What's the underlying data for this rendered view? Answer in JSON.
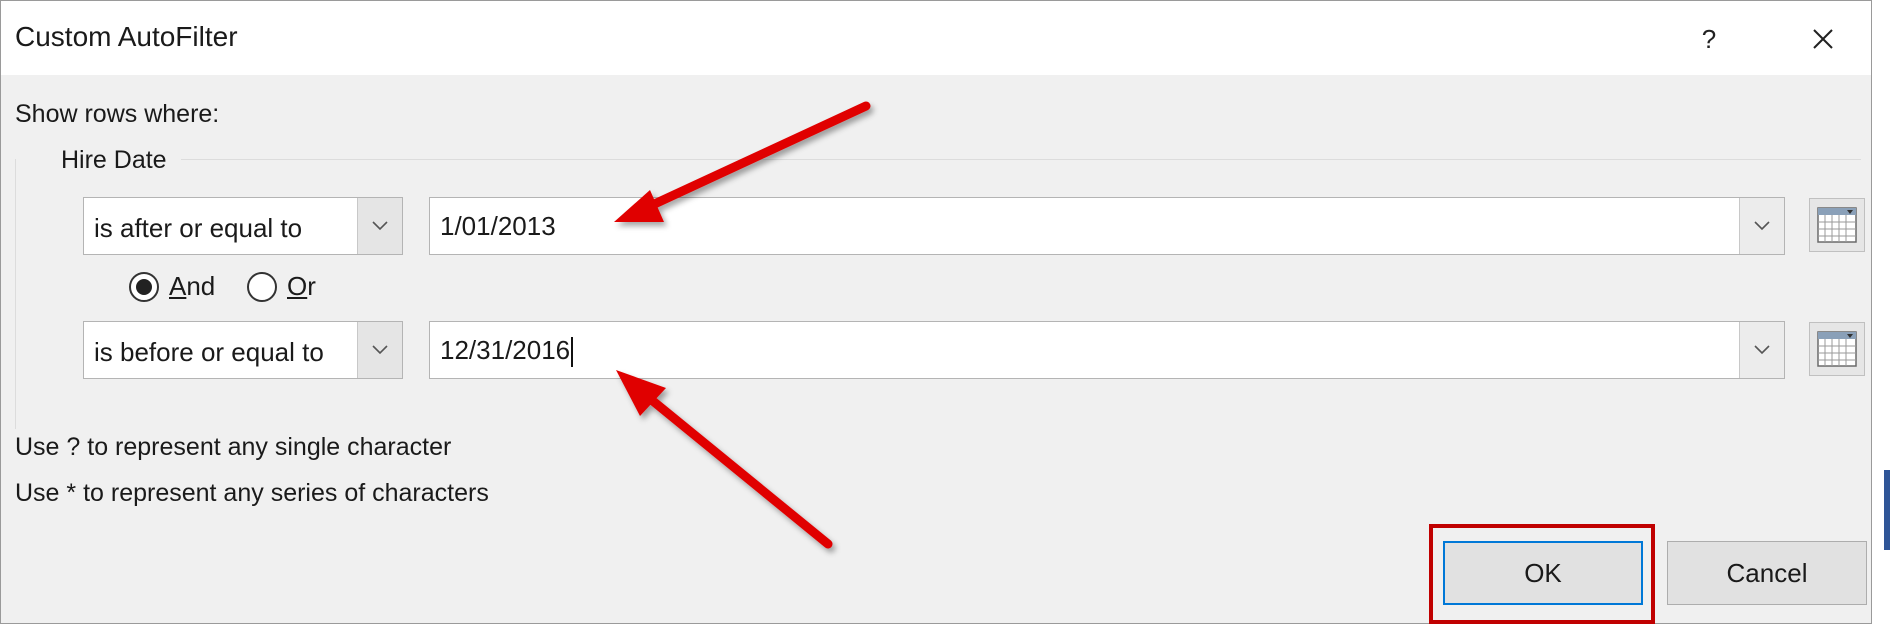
{
  "dialog": {
    "title": "Custom AutoFilter",
    "help_glyph": "?",
    "show_rows_label": "Show rows where:",
    "field_name": "Hire Date",
    "criteria1": {
      "operator": "is after or equal to",
      "value": "1/01/2013"
    },
    "logic": {
      "and_label_accel": "A",
      "and_label_rest": "nd",
      "or_label_accel": "O",
      "or_label_rest": "r",
      "selected": "And"
    },
    "criteria2": {
      "operator": "is before or equal to",
      "value": "12/31/2016"
    },
    "hint1": "Use ? to represent any single character",
    "hint2": "Use * to represent any series of characters",
    "ok_label": "OK",
    "cancel_label": "Cancel"
  },
  "colors": {
    "annotation_arrow": "#e00000",
    "highlight_box": "#c00000",
    "ok_focus_border": "#0078d7"
  },
  "icons": {
    "close": "close-icon",
    "dropdown": "chevron-down-icon",
    "date_picker": "calendar-icon"
  }
}
